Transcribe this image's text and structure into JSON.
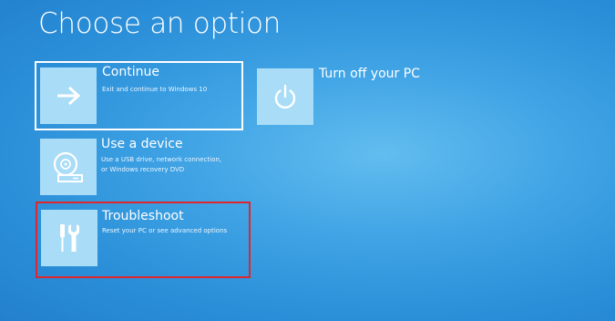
{
  "screen": {
    "title": "Choose an option"
  },
  "options": [
    {
      "title": "Continue",
      "description": "Exit and continue to Windows 10",
      "icon": "arrow-right-icon"
    },
    {
      "title": "Use a device",
      "description": "Use a USB drive, network connection,\nor Windows recovery DVD",
      "icon": "disc-drive-icon"
    },
    {
      "title": "Troubleshoot",
      "description": "Reset your PC or see advanced options",
      "icon": "tools-icon"
    },
    {
      "title": "Turn off your PC",
      "description": "",
      "icon": "power-icon"
    }
  ],
  "colors": {
    "background": "#3ea2e4",
    "tile": "#a9dcf6",
    "highlight_border": "#e0262d"
  }
}
